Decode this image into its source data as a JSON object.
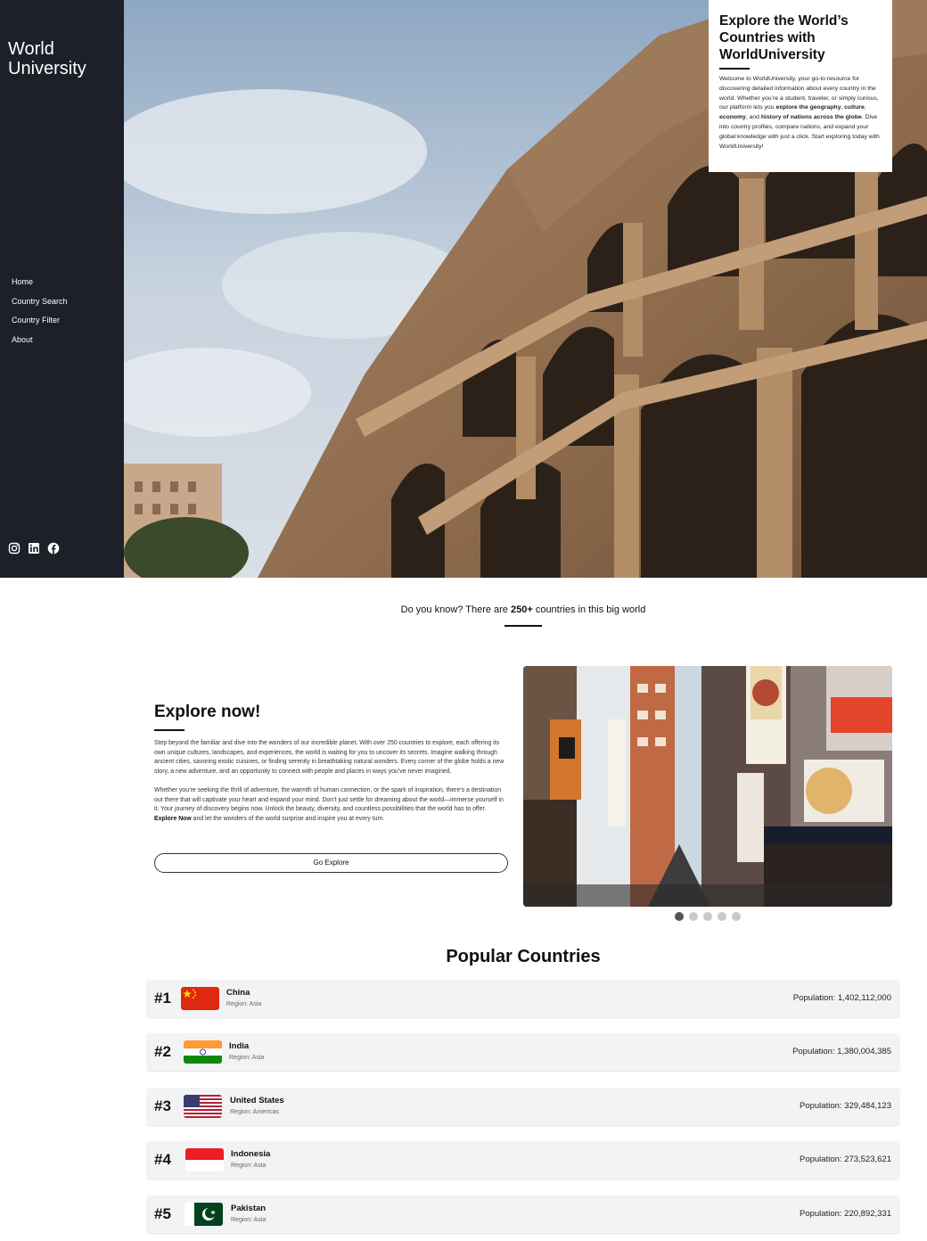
{
  "brand": {
    "line1": "World",
    "line2": "University"
  },
  "nav": [
    {
      "label": "Home"
    },
    {
      "label": "Country Search"
    },
    {
      "label": "Country Filter"
    },
    {
      "label": "About"
    }
  ],
  "social": [
    {
      "icon": "instagram-icon"
    },
    {
      "icon": "linkedin-icon"
    },
    {
      "icon": "facebook-icon"
    }
  ],
  "intro": {
    "title": "Explore the World’s Countries with WorldUniversity",
    "body_1": "Welcome to WorldUniversity, your go-to resource for discovering detailed information about every country in the world. Whether you’re a student, traveler, or simply curious, our platform lets you ",
    "bold_1": "explore the geography",
    "sep_1": ", ",
    "bold_2": "culture",
    "sep_2": ", ",
    "bold_3": "economy",
    "sep_3": ", and ",
    "bold_4": "history of nations across the globe",
    "body_2": ". Dive into country profiles, compare nations, and expand your global knowledge with just a click. Start exploring today with WorldUniversity!"
  },
  "know": {
    "prefix": "Do you know? There are ",
    "count": "250+",
    "suffix": " countries in this big world"
  },
  "explore": {
    "title": "Explore now!",
    "para_1": "Step beyond the familiar and dive into the wonders of our incredible planet. With over 250 countries to explore, each offering its own unique cultures, landscapes, and experiences, the world is waiting for you to uncover its secrets. Imagine walking through ancient cities, savoring exotic cuisines, or finding serenity in breathtaking natural wonders. Every corner of the globe holds a new story, a new adventure, and an opportunity to connect with people and places in ways you’ve never imagined.",
    "para_2": "Whether you’re seeking the thrill of adventure, the warmth of human connection, or the spark of inspiration, there’s a destination out there that will captivate your heart and expand your mind. Don’t just settle for dreaming about the world—immerse yourself in it. Your journey of discovery begins now. Unlock the beauty, diversity, and countless possibilities that the world has to offer. ",
    "para_2_bold": "Explore Now",
    "para_2_end": " and let the wonders of the world surprise and inspire you at every turn.",
    "button": "Go Explore"
  },
  "carousel": {
    "slide_count": 5,
    "active_index": 0
  },
  "popular": {
    "title": "Popular Countries",
    "countries": [
      {
        "rank": "#1",
        "name": "China",
        "region": "Region: Asia",
        "population": "Population: 1,402,112,000",
        "flag": "china-flag"
      },
      {
        "rank": "#2",
        "name": "India",
        "region": "Region: Asia",
        "population": "Population: 1,380,004,385",
        "flag": "india-flag"
      },
      {
        "rank": "#3",
        "name": "United States",
        "region": "Region: Americas",
        "population": "Population: 329,484,123",
        "flag": "usa-flag"
      },
      {
        "rank": "#4",
        "name": "Indonesia",
        "region": "Region: Asia",
        "population": "Population: 273,523,621",
        "flag": "indonesia-flag"
      },
      {
        "rank": "#5",
        "name": "Pakistan",
        "region": "Region: Asia",
        "population": "Population: 220,892,331",
        "flag": "pakistan-flag"
      }
    ]
  },
  "colors": {
    "sidebar": "#1d2029",
    "row_bg": "#f2f3f5",
    "accent": "#111111"
  }
}
